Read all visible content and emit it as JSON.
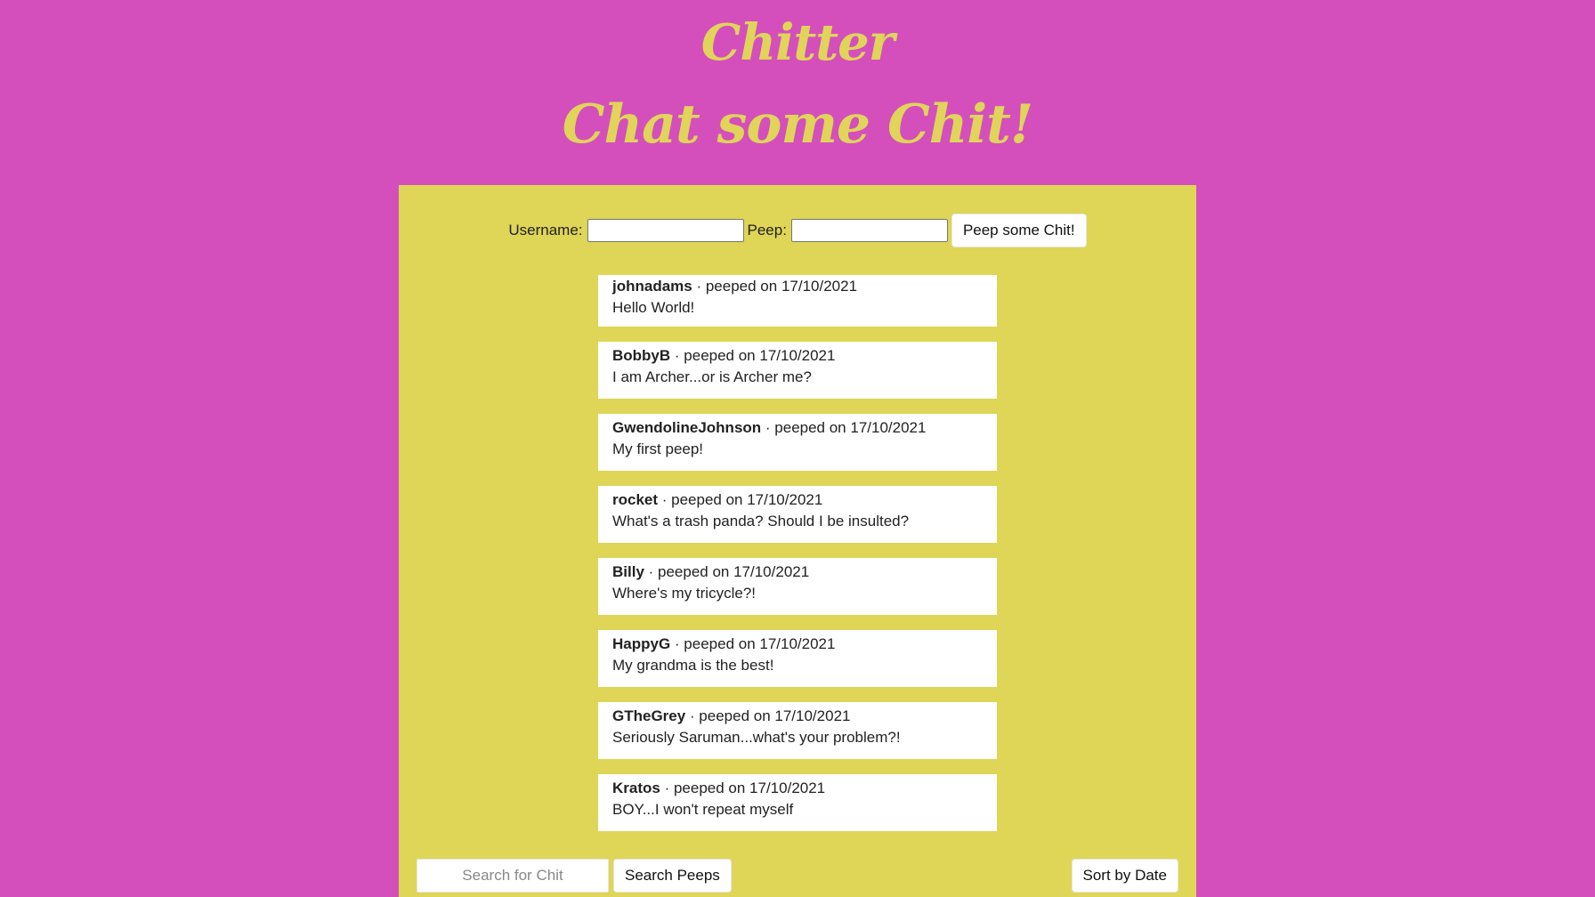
{
  "header": {
    "title": "Chitter",
    "subtitle": "Chat some Chit!"
  },
  "peep_form": {
    "username_label": "Username:",
    "username_value": "",
    "peep_label": "Peep:",
    "peep_value": "",
    "submit_label": "Peep some Chit!"
  },
  "peeps": [
    {
      "user": "johnadams",
      "meta": " · peeped on 17/10/2021",
      "text": "Hello World!"
    },
    {
      "user": "BobbyB",
      "meta": " · peeped on 17/10/2021",
      "text": "I am Archer...or is Archer me?"
    },
    {
      "user": "GwendolineJohnson",
      "meta": " · peeped on 17/10/2021",
      "text": "My first peep!"
    },
    {
      "user": "rocket",
      "meta": " · peeped on 17/10/2021",
      "text": "What's a trash panda? Should I be insulted?"
    },
    {
      "user": "Billy",
      "meta": " · peeped on 17/10/2021",
      "text": "Where's my tricycle?!"
    },
    {
      "user": "HappyG",
      "meta": " · peeped on 17/10/2021",
      "text": "My grandma is the best!"
    },
    {
      "user": "GTheGrey",
      "meta": " · peeped on 17/10/2021",
      "text": "Seriously Saruman...what's your problem?!"
    },
    {
      "user": "Kratos",
      "meta": " · peeped on 17/10/2021",
      "text": "BOY...I won't repeat myself"
    }
  ],
  "footer": {
    "search_placeholder": "Search for Chit",
    "search_button": "Search Peeps",
    "sort_button": "Sort by Date"
  },
  "colors": {
    "background": "#d44fbb",
    "panel": "#dfd556",
    "title": "#e0d45a"
  }
}
